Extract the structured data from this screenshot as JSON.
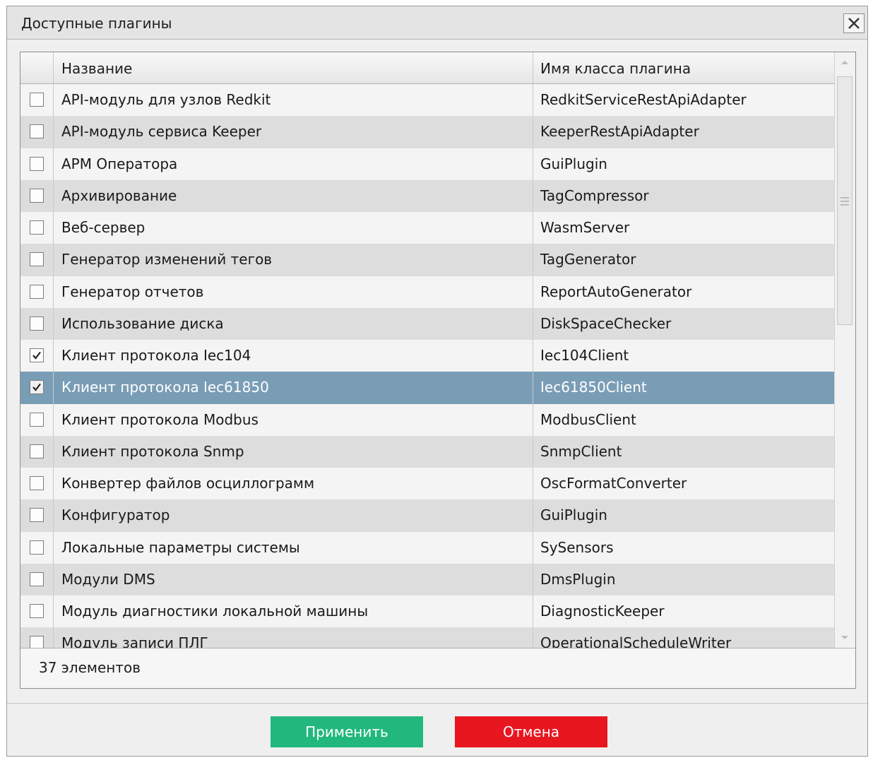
{
  "dialog": {
    "title": "Доступные плагины",
    "close_icon": "close-icon"
  },
  "grid": {
    "columns": {
      "name": "Название",
      "class_name": "Имя класса плагина"
    },
    "rows": [
      {
        "checked": false,
        "selected": false,
        "name": "API-модуль для узлов Redkit",
        "class_name": "RedkitServiceRestApiAdapter"
      },
      {
        "checked": false,
        "selected": false,
        "name": "API-модуль сервиса Keeper",
        "class_name": "KeeperRestApiAdapter"
      },
      {
        "checked": false,
        "selected": false,
        "name": "АРМ Оператора",
        "class_name": "GuiPlugin"
      },
      {
        "checked": false,
        "selected": false,
        "name": "Архивирование",
        "class_name": "TagCompressor"
      },
      {
        "checked": false,
        "selected": false,
        "name": "Веб-сервер",
        "class_name": "WasmServer"
      },
      {
        "checked": false,
        "selected": false,
        "name": "Генератор изменений тегов",
        "class_name": "TagGenerator"
      },
      {
        "checked": false,
        "selected": false,
        "name": "Генератор отчетов",
        "class_name": "ReportAutoGenerator"
      },
      {
        "checked": false,
        "selected": false,
        "name": "Использование диска",
        "class_name": "DiskSpaceChecker"
      },
      {
        "checked": true,
        "selected": false,
        "name": "Клиент протокола Iec104",
        "class_name": "Iec104Client"
      },
      {
        "checked": true,
        "selected": true,
        "name": "Клиент протокола Iec61850",
        "class_name": "Iec61850Client"
      },
      {
        "checked": false,
        "selected": false,
        "name": "Клиент протокола Modbus",
        "class_name": "ModbusClient"
      },
      {
        "checked": false,
        "selected": false,
        "name": "Клиент протокола Snmp",
        "class_name": "SnmpClient"
      },
      {
        "checked": false,
        "selected": false,
        "name": "Конвертер файлов осциллограмм",
        "class_name": "OscFormatConverter"
      },
      {
        "checked": false,
        "selected": false,
        "name": "Конфигуратор",
        "class_name": "GuiPlugin"
      },
      {
        "checked": false,
        "selected": false,
        "name": "Локальные параметры системы",
        "class_name": "SySensors"
      },
      {
        "checked": false,
        "selected": false,
        "name": "Модули DMS",
        "class_name": "DmsPlugin"
      },
      {
        "checked": false,
        "selected": false,
        "name": "Модуль диагностики локальной машины",
        "class_name": "DiagnosticKeeper"
      },
      {
        "checked": false,
        "selected": false,
        "name": "Модуль записи ПЛГ",
        "class_name": "OperationalScheduleWriter"
      }
    ],
    "footer": {
      "count_text": "37 элементов"
    }
  },
  "buttons": {
    "apply": "Применить",
    "cancel": "Отмена"
  },
  "colors": {
    "selected_row": "#7a9db6",
    "apply": "#22b87d",
    "cancel": "#e8161f"
  }
}
